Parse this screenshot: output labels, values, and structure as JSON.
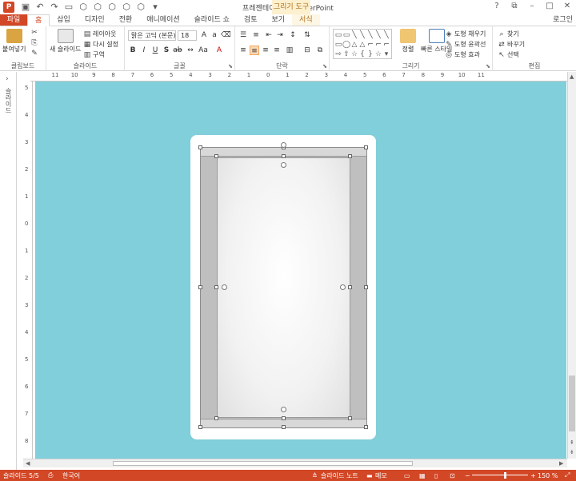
{
  "titlebar": {
    "app_icon": "P",
    "title": "프레젠테이션1 - PowerPoint",
    "context_title": "그리기 도구"
  },
  "tabs": [
    {
      "label": "파일"
    },
    {
      "label": "홈"
    },
    {
      "label": "삽입"
    },
    {
      "label": "디자인"
    },
    {
      "label": "전환"
    },
    {
      "label": "애니메이션"
    },
    {
      "label": "슬라이드 쇼"
    },
    {
      "label": "검토"
    },
    {
      "label": "보기"
    },
    {
      "label": "서식"
    }
  ],
  "login_label": "로그인",
  "ribbon": {
    "clipboard": {
      "paste": "붙여넣기",
      "label": "클립보드"
    },
    "slides": {
      "new_slide": "새 슬라이드",
      "layout": "레이아웃",
      "reset": "다시 설정",
      "section": "구역",
      "label": "슬라이드"
    },
    "font": {
      "font_name": "맑은 고딕 (본문)",
      "font_size": "18",
      "label": "글꼴"
    },
    "paragraph": {
      "label": "단락"
    },
    "drawing": {
      "arrange": "정렬",
      "quick_styles": "빠른 스타일",
      "fill": "도형 채우기",
      "outline": "도형 윤곽선",
      "effects": "도형 효과",
      "label": "그리기"
    },
    "editing": {
      "find": "찾기",
      "replace": "바꾸기",
      "select": "선택",
      "label": "편집"
    }
  },
  "left_pane": {
    "label": "슬라이드"
  },
  "ruler": {
    "h_ticks": [
      "11",
      "10",
      "9",
      "8",
      "7",
      "6",
      "5",
      "4",
      "3",
      "2",
      "1",
      "0",
      "1",
      "2",
      "3",
      "4",
      "5",
      "6",
      "7",
      "8",
      "9",
      "10",
      "11"
    ],
    "v_ticks": [
      "5",
      "4",
      "3",
      "2",
      "1",
      "0",
      "1",
      "2",
      "3",
      "4",
      "5",
      "6",
      "7",
      "8"
    ]
  },
  "statusbar": {
    "slide_info": "슬라이드 5/5",
    "language": "한국어",
    "notes": "슬라이드 노트",
    "comments": "메모",
    "zoom": "150 %"
  }
}
